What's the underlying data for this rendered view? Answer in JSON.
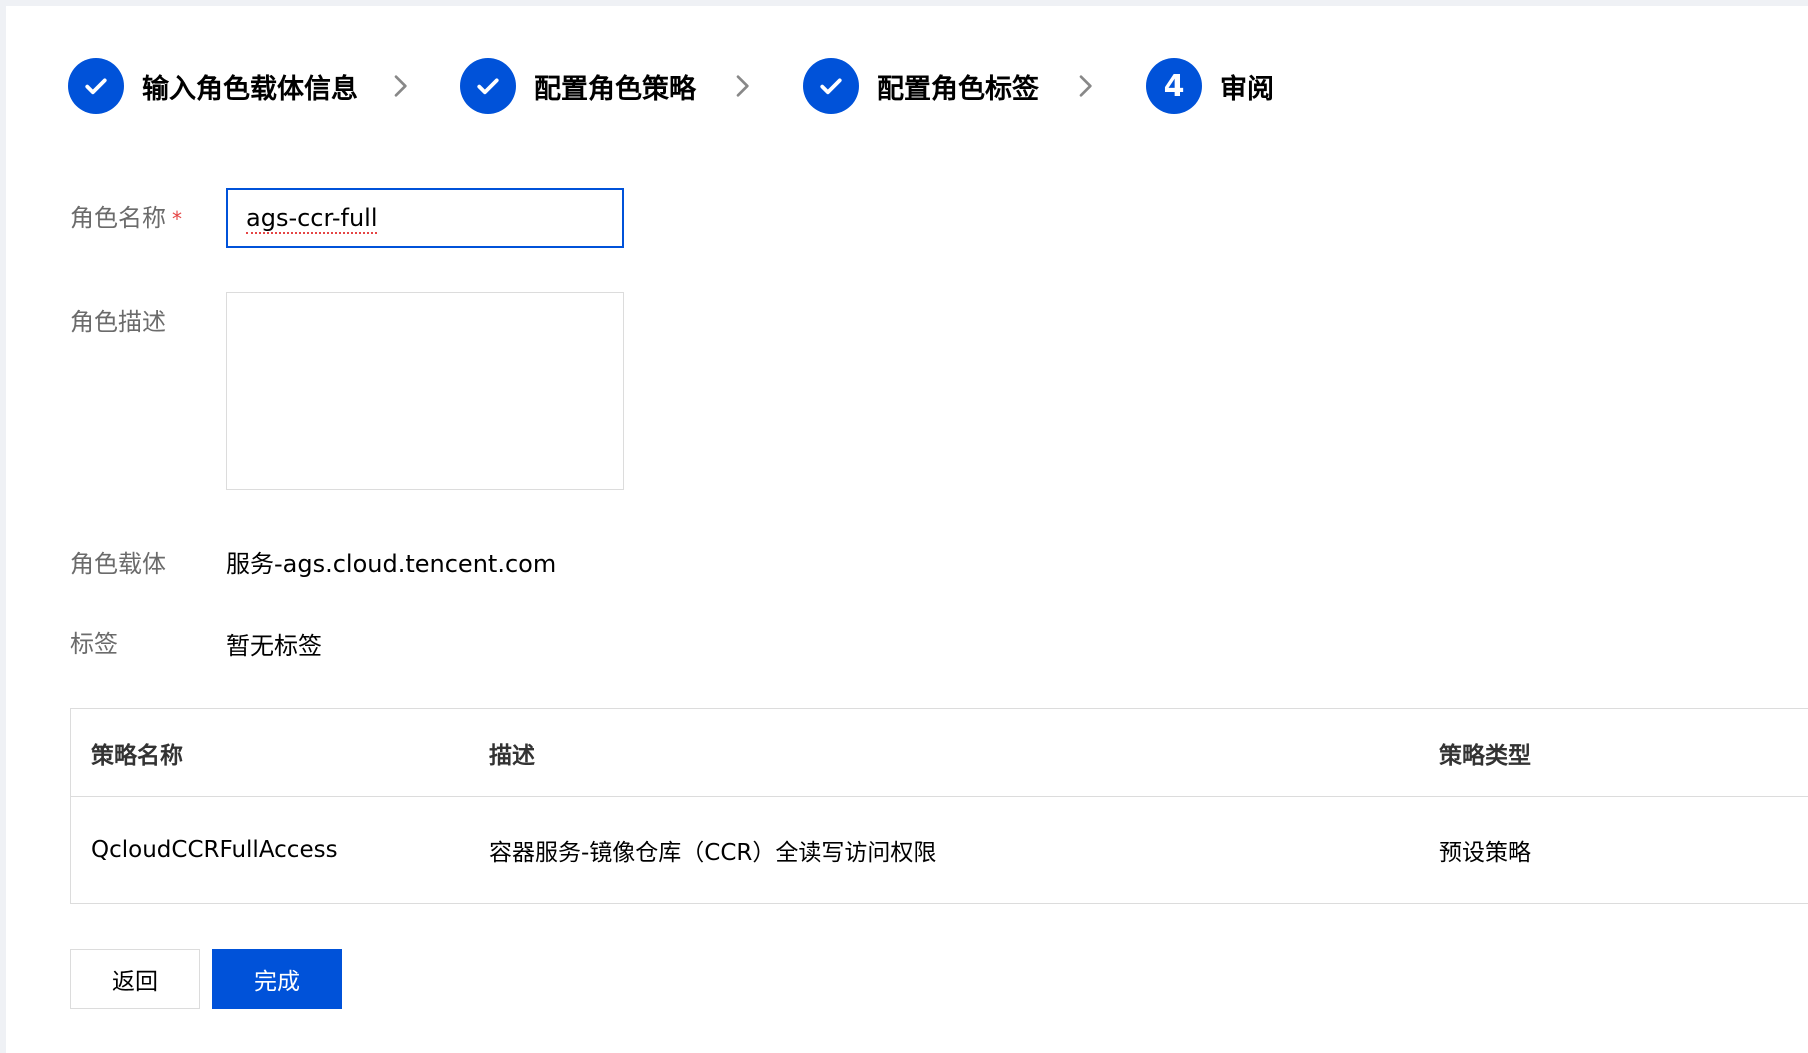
{
  "steps": [
    {
      "label": "输入角色载体信息",
      "status": "done"
    },
    {
      "label": "配置角色策略",
      "status": "done"
    },
    {
      "label": "配置角色标签",
      "status": "done"
    },
    {
      "label": "审阅",
      "status": "current",
      "number": "4"
    }
  ],
  "form": {
    "role_name_label": "角色名称",
    "required_mark": "*",
    "role_name_value": "ags-ccr-full",
    "role_desc_label": "角色描述",
    "role_desc_value": "",
    "role_carrier_label": "角色载体",
    "role_carrier_value": "服务-ags.cloud.tencent.com",
    "tags_label": "标签",
    "tags_value": "暂无标签"
  },
  "policy_table": {
    "headers": [
      "策略名称",
      "描述",
      "策略类型"
    ],
    "rows": [
      [
        "QcloudCCRFullAccess",
        "容器服务-镜像仓库（CCR）全读写访问权限",
        "预设策略"
      ]
    ]
  },
  "buttons": {
    "back_label": "返回",
    "done_label": "完成"
  },
  "colors": {
    "primary": "#0052d9",
    "required": "#e54545",
    "label_gray": "#6b6b6b",
    "border": "#dcdcdc"
  },
  "icons": {
    "step_done": "check-icon",
    "step_separator": "chevron-right-icon"
  }
}
